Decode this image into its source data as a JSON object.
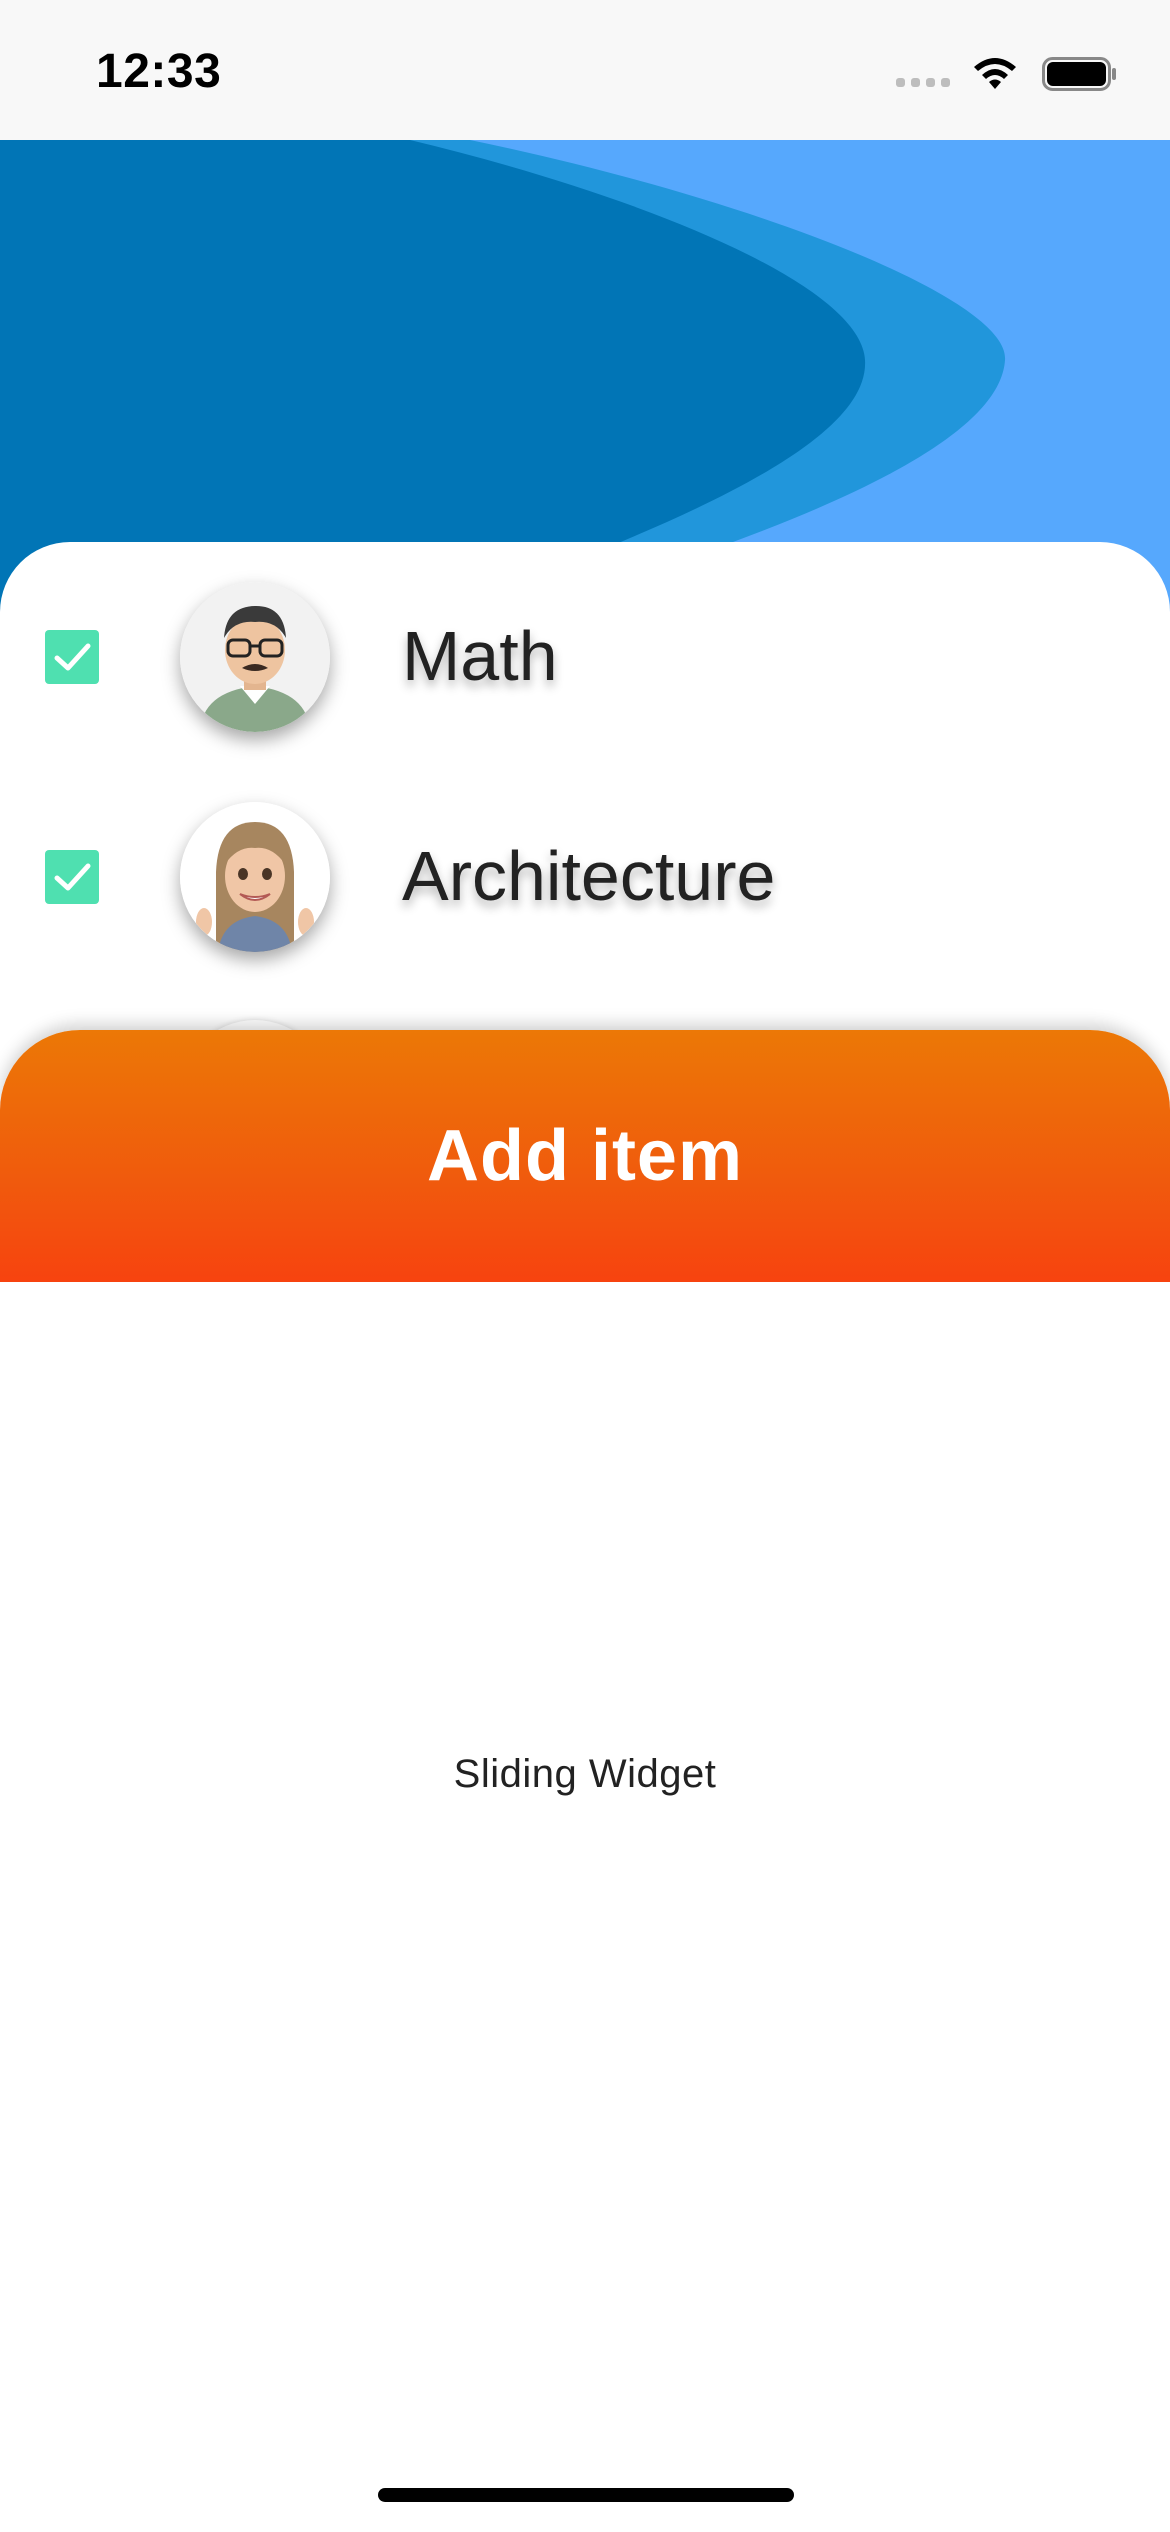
{
  "status_bar": {
    "time": "12:33",
    "icons": [
      "cellular-signal-icon",
      "wifi-icon",
      "battery-icon"
    ]
  },
  "header": {
    "colors": {
      "dark": "#0175b6",
      "mid": "#2196db",
      "light": "#56a8fd"
    }
  },
  "list": {
    "items": [
      {
        "label": "Math",
        "checked": true,
        "avatar": "man-memoji-avatar"
      },
      {
        "label": "Architecture",
        "checked": true,
        "avatar": "woman-memoji-avatar"
      }
    ],
    "checkbox_color": "#4fe0b0"
  },
  "add_button": {
    "label": "Add item",
    "gradient": [
      "#ec7806",
      "#f7430f"
    ]
  },
  "sliding_panel": {
    "label": "Sliding Widget"
  }
}
